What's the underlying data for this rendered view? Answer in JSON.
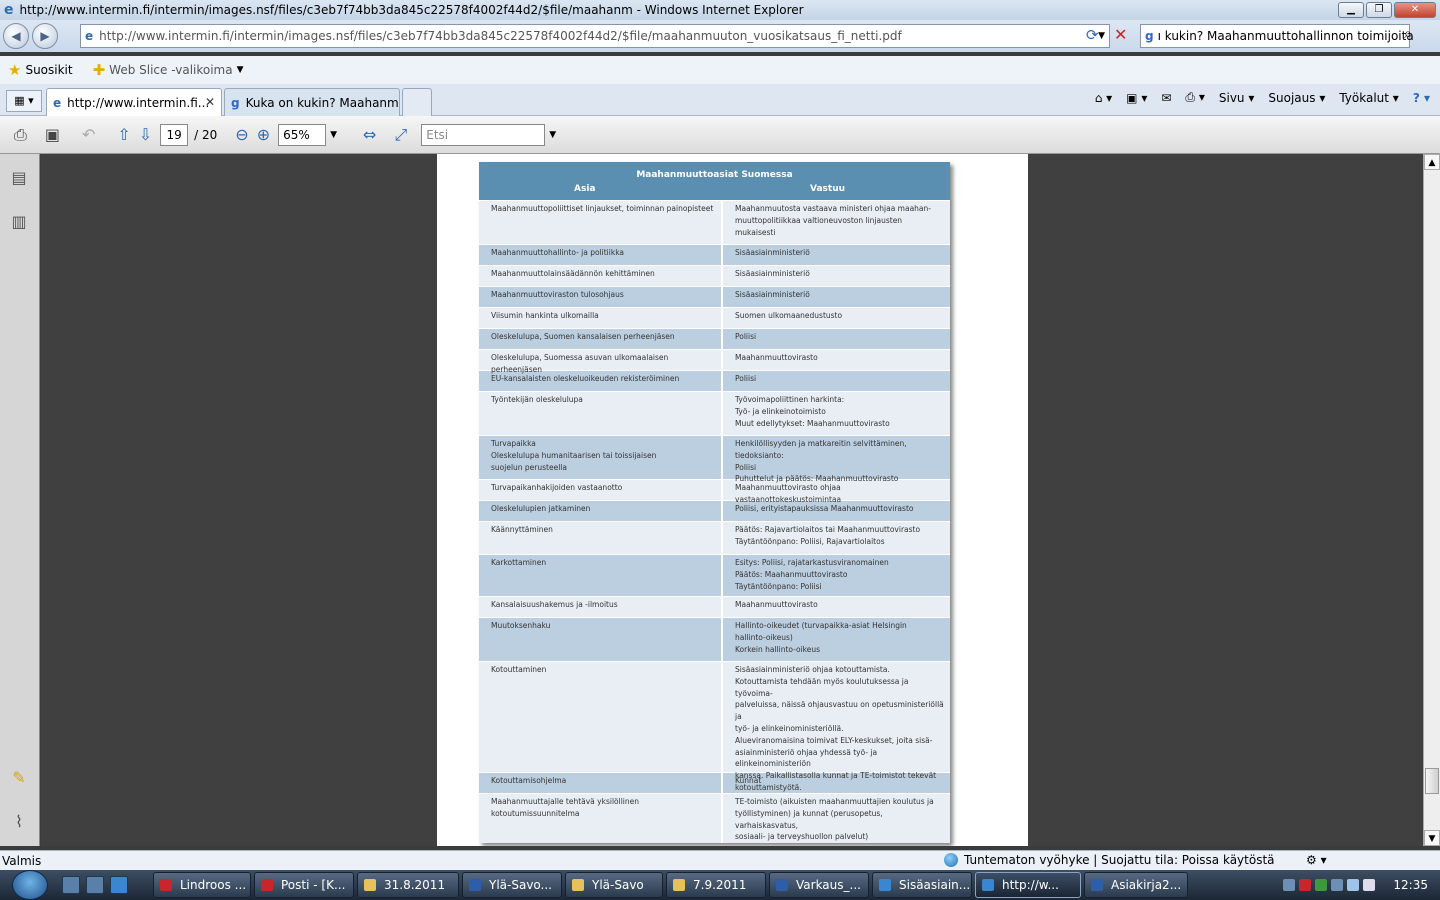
{
  "window": {
    "title": "http://www.intermin.fi/intermin/images.nsf/files/c3eb7f74bb3da845c22578f4002f44d2/$file/maahanm - Windows Internet Explorer"
  },
  "address_bar": {
    "url": "http://www.intermin.fi/intermin/images.nsf/files/c3eb7f74bb3da845c22578f4002f44d2/$file/maahanmuuton_vuosikatsaus_fi_netti.pdf"
  },
  "search_bar": {
    "value": "ı kukin? Maahanmuuttohallinnon toimijoita"
  },
  "favorites_bar": {
    "favorites_label": "Suosikit",
    "webslice_label": "Web Slice -valikoima"
  },
  "tabs": [
    {
      "label": "http://www.intermin.fi..."
    },
    {
      "label": "Kuka on kukin? Maahanm..."
    }
  ],
  "command_bar": {
    "page": "Sivu",
    "safety": "Suojaus",
    "tools": "Työkalut"
  },
  "pdf_toolbar": {
    "current_page": "19",
    "total_pages": "/ 20",
    "zoom": "65%",
    "find_placeholder": "Etsi"
  },
  "pdf_content": {
    "table_title": "Maahanmuuttoasiat Suomessa",
    "col_left": "Asia",
    "col_right": "Vastuu",
    "rows": [
      {
        "asia": "Maahanmuuttopoliittiset linjaukset, toiminnan painopisteet",
        "vastuu": "Maahanmuutosta vastaava ministeri ohjaa maahan-\nmuuttopolitiikkaa valtioneuvoston linjausten\nmukaisesti"
      },
      {
        "asia": "Maahanmuuttohallinto- ja politiikka",
        "vastuu": "Sisäasiainministeriö"
      },
      {
        "asia": "Maahanmuuttolainsäädännön kehittäminen",
        "vastuu": "Sisäasiainministeriö"
      },
      {
        "asia": "Maahanmuuttoviraston tulosohjaus",
        "vastuu": "Sisäasiainministeriö"
      },
      {
        "asia": "Viisumin hankinta ulkomailla",
        "vastuu": "Suomen ulkomaanedustusto"
      },
      {
        "asia": "Oleskelulupa, Suomen kansalaisen perheenjäsen",
        "vastuu": "Poliisi"
      },
      {
        "asia": "Oleskelulupa, Suomessa asuvan ulkomaalaisen perheenjäsen",
        "vastuu": "Maahanmuuttovirasto"
      },
      {
        "asia": "EU-kansalaisten oleskeluoikeuden rekisteröiminen",
        "vastuu": "Poliisi"
      },
      {
        "asia": "Työntekijän oleskelulupa",
        "vastuu": "Työvoimapoliittinen harkinta:\nTyö- ja elinkeinotoimisto\nMuut edellytykset: Maahanmuuttovirasto"
      },
      {
        "asia": "Turvapaikka\nOleskelulupa humanitaarisen tai toissijaisen\nsuojelun perusteella",
        "vastuu": "Henkilöllisyyden ja matkareitin selvittäminen, tiedoksianto:\nPoliisi\nPuhuttelut ja päätös: Maahanmuuttovirasto"
      },
      {
        "asia": "Turvapaikanhakijoiden vastaanotto",
        "vastuu": "Maahanmuuttovirasto ohjaa vastaanottokeskustoimintaa"
      },
      {
        "asia": "Oleskelulupien jatkaminen",
        "vastuu": "Poliisi, erityistapauksissa Maahanmuuttovirasto"
      },
      {
        "asia": "Käännyttäminen",
        "vastuu": "Päätös: Rajavartiolaitos tai Maahanmuuttovirasto\nTäytäntöönpano: Poliisi, Rajavartiolaitos"
      },
      {
        "asia": "Karkottaminen",
        "vastuu": "Esitys: Poliisi, rajatarkastusviranomainen\nPäätös: Maahanmuuttovirasto\nTäytäntöönpano: Poliisi"
      },
      {
        "asia": "Kansalaisuushakemus ja -ilmoitus",
        "vastuu": "Maahanmuuttovirasto"
      },
      {
        "asia": "Muutoksenhaku",
        "vastuu": "Hallinto-oikeudet (turvapaikka-asiat Helsingin\nhallinto-oikeus)\nKorkein hallinto-oikeus"
      },
      {
        "asia": "Kotouttaminen",
        "vastuu": "Sisäasiainministeriö ohjaa kotouttamista.\nKotouttamista tehdään myös koulutuksessa ja työvoima-\npalveluissa, näissä ohjausvastuu on  opetusministeriöllä ja\ntyö- ja elinkeinoministeriöllä.\nAlueviranomaisina toimivat ELY-keskukset, joita sisä-\nasiainministeriö ohjaa yhdessä työ- ja elinkeinoministeriön\nkanssa. Paikallistasolla kunnat ja TE-toimistot tekevät\nkotouttamistyötä."
      },
      {
        "asia": "Kotouttamisohjelma",
        "vastuu": "Kunnat"
      },
      {
        "asia": "Maahanmuuttajalle tehtävä yksilöllinen\nkotoutumissuunnitelma",
        "vastuu": "TE-toimisto (aikuisten maahanmuuttajien koulutus ja\ntyöllistyminen) ja kunnat (perusopetus, varhaiskasvatus,\nsosiaali- ja terveyshuollon palvelut)"
      }
    ]
  },
  "status_bar": {
    "left": "Valmis",
    "zone": "Tuntematon vyöhyke | Suojattu tila: Poissa käytöstä"
  },
  "taskbar": {
    "items": [
      {
        "label": "Lindroos ...",
        "color": "#c8262a"
      },
      {
        "label": "Posti - [K...",
        "color": "#c8262a"
      },
      {
        "label": "31.8.2011",
        "color": "#e5c25a"
      },
      {
        "label": "Ylä-Savo...",
        "color": "#2f5ea8"
      },
      {
        "label": "Ylä-Savo",
        "color": "#e5c25a"
      },
      {
        "label": "7.9.2011",
        "color": "#e5c25a"
      },
      {
        "label": "Varkaus_...",
        "color": "#2f5ea8"
      },
      {
        "label": "Sisäasiain...",
        "color": "#3a86d1"
      },
      {
        "label": "http://w...",
        "color": "#3a86d1"
      },
      {
        "label": "Asiakirja2...",
        "color": "#2f5ea8"
      }
    ],
    "clock": "12:35"
  }
}
